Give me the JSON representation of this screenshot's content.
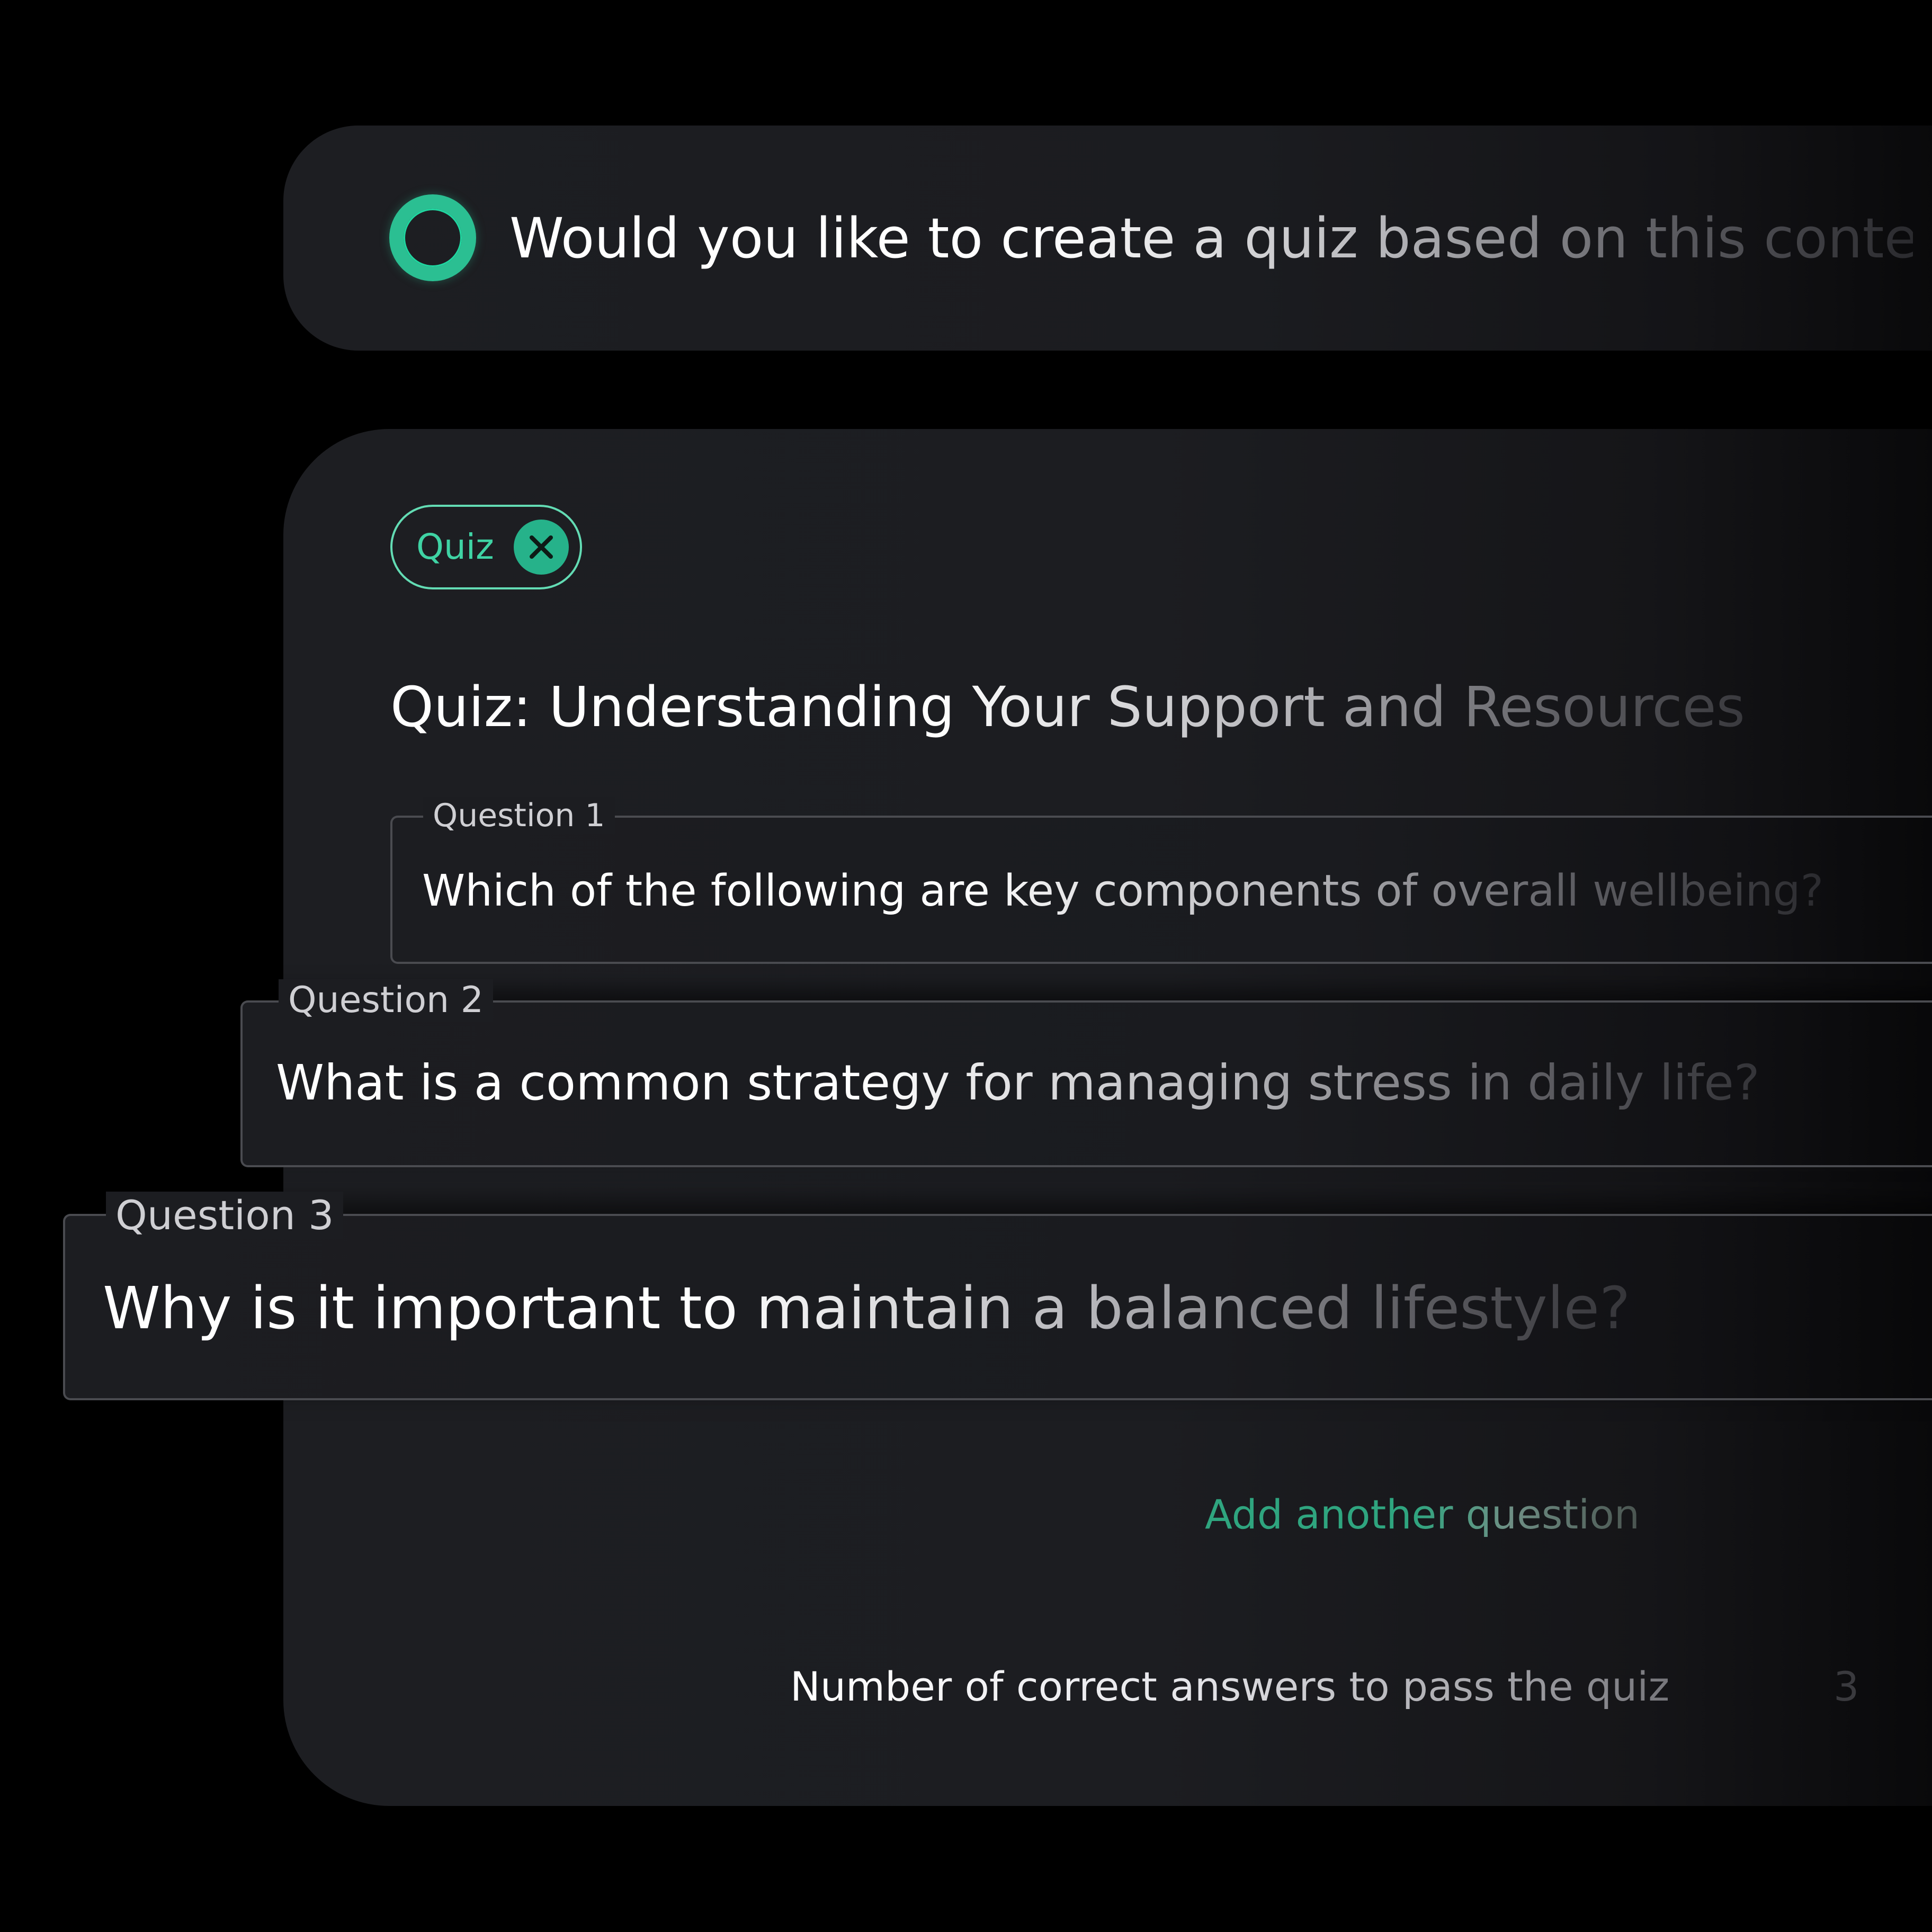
{
  "prompt": {
    "text": "Would you like to create a quiz based on this content?",
    "icon": "ring-icon"
  },
  "quiz_card": {
    "chip": {
      "label": "Quiz",
      "close_icon": "close-icon"
    },
    "title": "Quiz: Understanding Your Support and Resources",
    "questions": [
      {
        "label": "Question 1",
        "text": "Which of the following are key components of overall wellbeing?"
      },
      {
        "label": "Question 2",
        "text": "What is a common strategy for managing stress in daily life?"
      },
      {
        "label": "Question 3",
        "text": "Why is it important to maintain a balanced lifestyle?"
      }
    ],
    "add_question_label": "Add another question",
    "pass_threshold": {
      "label": "Number of correct answers to pass the quiz",
      "value": "3"
    }
  },
  "colors": {
    "background": "#000000",
    "card": "#1d1e22",
    "accent": "#2bbf92",
    "chip_border": "#63dcb4",
    "field_border": "#4a4b50"
  }
}
